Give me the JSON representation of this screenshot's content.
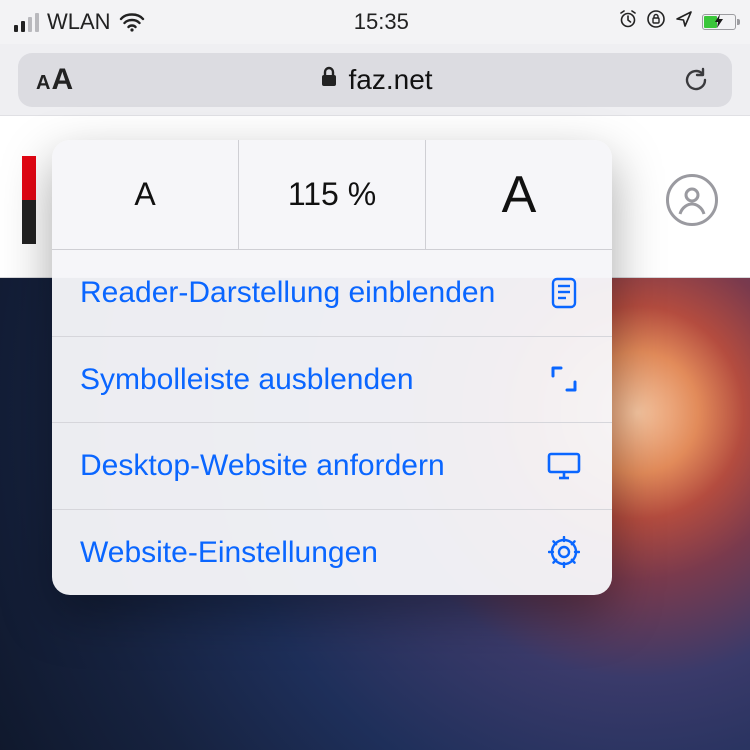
{
  "status": {
    "network": "WLAN",
    "time": "15:35"
  },
  "url_bar": {
    "domain": "faz.net"
  },
  "popover": {
    "zoom_level": "115 %",
    "items": {
      "reader": "Reader-Darstellung einblenden",
      "hide_toolbar": "Symbolleiste ausblenden",
      "desktop": "Desktop-Website anfordern",
      "settings": "Website-Einstellungen"
    }
  }
}
